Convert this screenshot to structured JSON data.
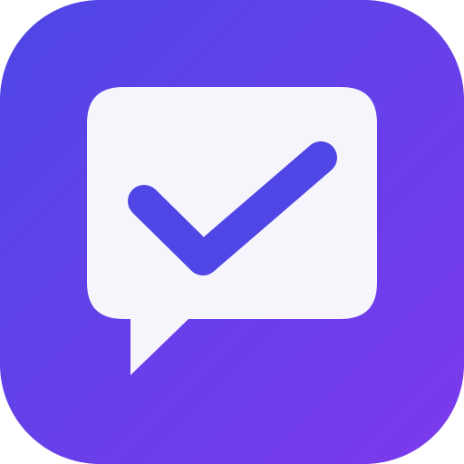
{
  "app_icon": {
    "icon_name": "chat-bubble-checkmark-icon",
    "colors": {
      "background_gradient_start": "#4f46e5",
      "background_gradient_end": "#7c3aed",
      "bubble": "#f6f5fc",
      "checkmark": "#4f46e5"
    }
  }
}
